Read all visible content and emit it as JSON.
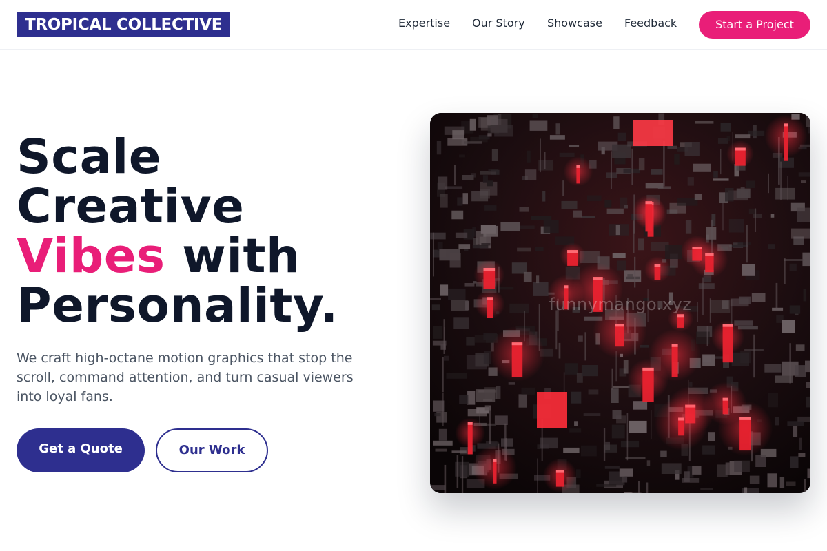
{
  "brand": {
    "logo_text": "TROPICAL COLLECTIVE"
  },
  "nav": {
    "links": [
      {
        "label": "Expertise"
      },
      {
        "label": "Our Story"
      },
      {
        "label": "Showcase"
      },
      {
        "label": "Feedback"
      }
    ],
    "cta_label": "Start a Project"
  },
  "hero": {
    "headline": {
      "line1": "Scale",
      "line2": "Creative",
      "accent": "Vibes",
      "line3_rest": " with",
      "line4": "Personality."
    },
    "subtext": "We craft high-octane motion graphics that stop the scroll, command attention, and turn casual viewers into loyal fans.",
    "primary_button": "Get a Quote",
    "secondary_button": "Our Work",
    "image": {
      "watermark": "funnymango.xyz",
      "subject": "isometric dark circuit city with glowing red blocks"
    }
  },
  "colors": {
    "brand_indigo": "#2e2f8f",
    "accent_pink": "#e91e78",
    "headline": "#0f172a",
    "body_text": "#4b5563"
  }
}
